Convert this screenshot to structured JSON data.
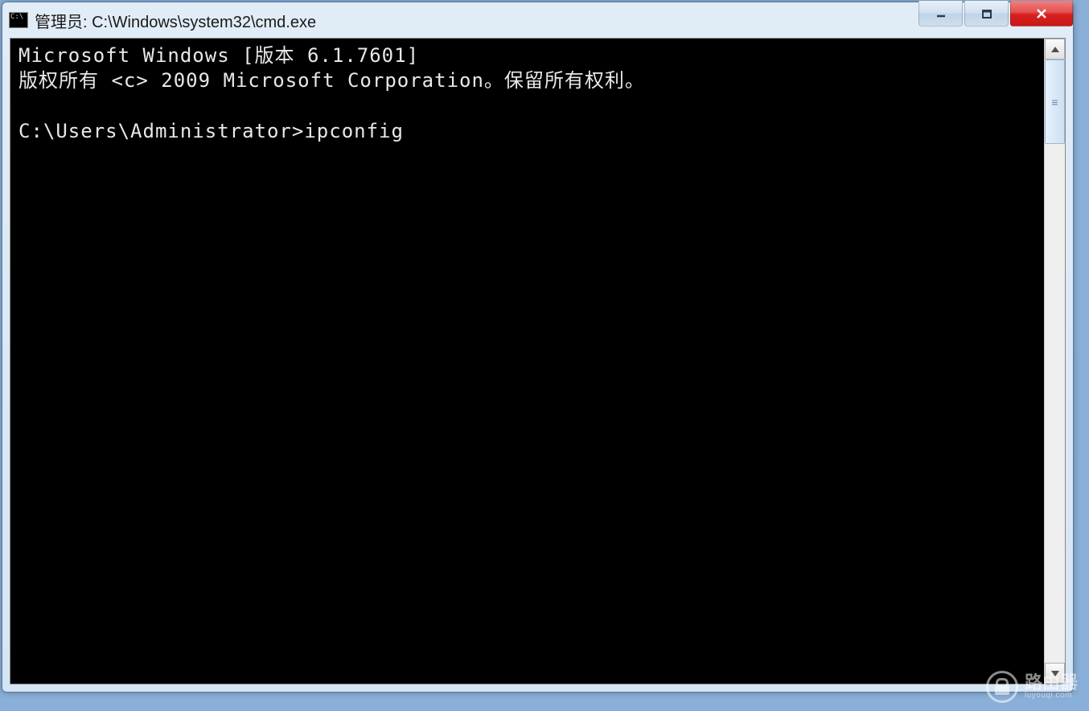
{
  "window": {
    "title": "管理员: C:\\Windows\\system32\\cmd.exe"
  },
  "console": {
    "line1": "Microsoft Windows [版本 6.1.7601]",
    "line2": "版权所有 <c> 2009 Microsoft Corporation。保留所有权利。",
    "blank": "",
    "prompt": "C:\\Users\\Administrator>",
    "command": "ipconfig"
  },
  "watermark": {
    "main": "路由器",
    "sub": "luyouqi.com"
  }
}
